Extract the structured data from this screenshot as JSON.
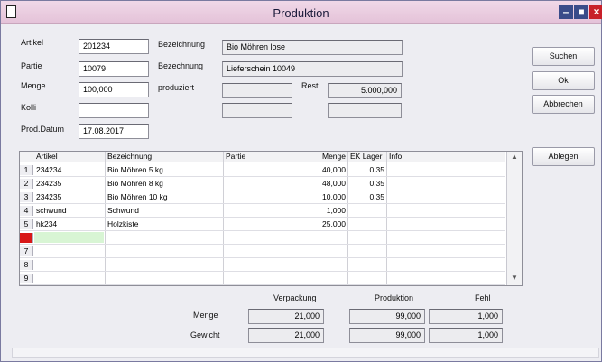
{
  "window": {
    "title": "Produktion"
  },
  "form": {
    "artikel_label": "Artikel",
    "artikel_value": "201234",
    "partie_label": "Partie",
    "partie_value": "10079",
    "menge_label": "Menge",
    "menge_value": "100,000",
    "kolli_label": "Kolli",
    "kolli_value": "",
    "proddatum_label": "Prod.Datum",
    "proddatum_value": "17.08.2017",
    "bez1_label": "Bezeichnung",
    "bez1_value": "Bio Möhren lose",
    "bez2_label": "Bezechnung",
    "bez2_value": "Lieferschein 10049",
    "produziert_label": "produziert",
    "produziert_value": "",
    "rest_label": "Rest",
    "rest_value": "5.000,000",
    "extra1_value": "",
    "extra2_value": ""
  },
  "buttons": {
    "suchen": "Suchen",
    "ok": "Ok",
    "abbrechen": "Abbrechen",
    "ablegen": "Ablegen"
  },
  "table": {
    "headers": [
      "Artikel",
      "Bezeichnung",
      "Partie",
      "Menge",
      "EK Lager",
      "Info"
    ],
    "rows": [
      {
        "num": "1",
        "artikel": "234234",
        "bez": "Bio Möhren 5 kg",
        "partie": "",
        "menge": "40,000",
        "ek": "0,35",
        "info": ""
      },
      {
        "num": "2",
        "artikel": "234235",
        "bez": "Bio Möhren 8 kg",
        "partie": "",
        "menge": "48,000",
        "ek": "0,35",
        "info": ""
      },
      {
        "num": "3",
        "artikel": "234235",
        "bez": "Bio Möhren 10 kg",
        "partie": "",
        "menge": "10,000",
        "ek": "0,35",
        "info": ""
      },
      {
        "num": "4",
        "artikel": "schwund",
        "bez": "Schwund",
        "partie": "",
        "menge": "1,000",
        "ek": "",
        "info": ""
      },
      {
        "num": "5",
        "artikel": "hk234",
        "bez": "Holzkiste",
        "partie": "",
        "menge": "25,000",
        "ek": "",
        "info": ""
      },
      {
        "num": "6",
        "artikel": "",
        "bez": "",
        "partie": "",
        "menge": "",
        "ek": "",
        "info": ""
      },
      {
        "num": "7",
        "artikel": "",
        "bez": "",
        "partie": "",
        "menge": "",
        "ek": "",
        "info": ""
      },
      {
        "num": "8",
        "artikel": "",
        "bez": "",
        "partie": "",
        "menge": "",
        "ek": "",
        "info": ""
      },
      {
        "num": "9",
        "artikel": "",
        "bez": "",
        "partie": "",
        "menge": "",
        "ek": "",
        "info": ""
      }
    ]
  },
  "summary": {
    "col_verpackung": "Verpackung",
    "col_produktion": "Produktion",
    "col_fehl": "Fehl",
    "menge_label": "Menge",
    "gewicht_label": "Gewicht",
    "menge": {
      "verpackung": "21,000",
      "produktion": "99,000",
      "fehl": "1,000"
    },
    "gewicht": {
      "verpackung": "21,000",
      "produktion": "99,000",
      "fehl": "1,000"
    }
  }
}
